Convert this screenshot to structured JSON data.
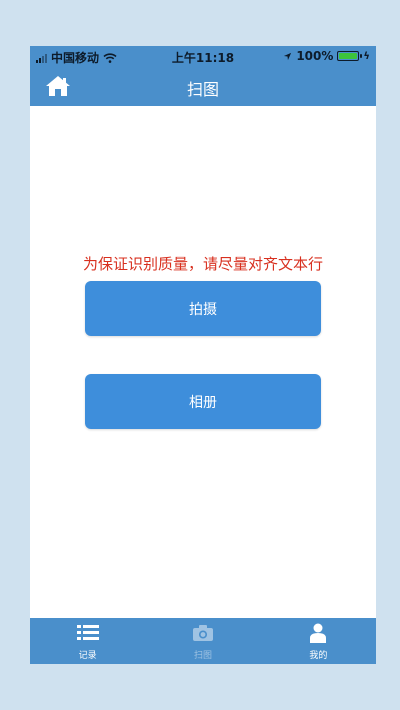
{
  "status_bar": {
    "carrier": "中国移动",
    "time": "上午11:18",
    "battery_percent": "100%",
    "battery_level": 1.0
  },
  "nav": {
    "title": "扫图",
    "home_icon": "home-icon"
  },
  "main": {
    "hint": "为保证识别质量，请尽量对齐文本行",
    "shoot_label": "拍摄",
    "album_label": "相册"
  },
  "tabs": [
    {
      "label": "记录",
      "icon": "list-icon",
      "active": true
    },
    {
      "label": "扫图",
      "icon": "camera-icon",
      "active": false
    },
    {
      "label": "我的",
      "icon": "user-icon",
      "active": true
    }
  ],
  "colors": {
    "background": "#cfe1ef",
    "bar": "#4a8fcb",
    "button": "#3e8edb",
    "hint_text": "#d8301f",
    "battery": "#3cc43c"
  }
}
